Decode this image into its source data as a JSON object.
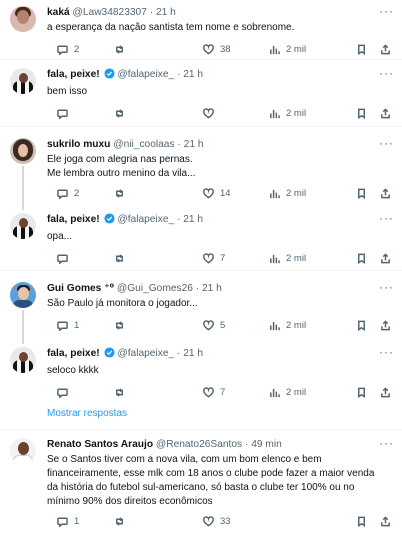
{
  "more_glyph": "···",
  "show_replies": "Mostrar respostas",
  "colors": {
    "link": "#1d9bf0",
    "muted": "#536471",
    "verified": "#1d9bf0"
  },
  "tweets": [
    {
      "name": "kaká",
      "handle": "@Law34823307",
      "dot": "·",
      "time": "21 h",
      "lines": [
        "a esperança da nação santista tem nome e sobrenome."
      ],
      "replies": "2",
      "retweets": "",
      "likes": "38",
      "views": "2 mil"
    },
    {
      "name": "fala, peixe!",
      "handle": "@falapeixe_",
      "dot": "·",
      "time": "21 h",
      "verified": true,
      "lines": [
        "bem isso"
      ],
      "replies": "",
      "retweets": "",
      "likes": "",
      "views": "2 mil"
    },
    {
      "name": "sukrilo muxu",
      "handle": "@nii_coolaas",
      "dot": "·",
      "time": "21 h",
      "lines": [
        "Ele joga com alegria nas pernas.",
        "Me lembra outro menino da vila..."
      ],
      "replies": "2",
      "retweets": "",
      "likes": "14",
      "views": "2 mil"
    },
    {
      "name": "fala, peixe!",
      "handle": "@falapeixe_",
      "dot": "·",
      "time": "21 h",
      "verified": true,
      "lines": [
        "opa..."
      ],
      "replies": "",
      "retweets": "",
      "likes": "7",
      "views": "2 mil"
    },
    {
      "name": "Gui Gomes",
      "name_suffix": "⁺⁰",
      "handle": "@Gui_Gomes26",
      "dot": "·",
      "time": "21 h",
      "lines": [
        "São Paulo já monitora o jogador..."
      ],
      "replies": "1",
      "retweets": "",
      "likes": "5",
      "views": "2 mil"
    },
    {
      "name": "fala, peixe!",
      "handle": "@falapeixe_",
      "dot": "·",
      "time": "21 h",
      "verified": true,
      "lines": [
        "seloco kkkk"
      ],
      "replies": "",
      "retweets": "",
      "likes": "7",
      "views": "2 mil"
    },
    {
      "name": "Renato Santos Araujo",
      "handle": "@Renato26Santos",
      "dot": "·",
      "time": "49 min",
      "lines": [
        "Se o Santos  tiver com a nova vila, com um bom elenco e bem",
        "financeiramente, esse mlk com 18 anos o clube pode fazer a maior venda",
        "da história do futebol sul-americano, só basta o clube  ter 100% ou no",
        "mínimo 90% dos direitos econômicos"
      ],
      "replies": "1",
      "retweets": "",
      "likes": "33",
      "views": ""
    }
  ]
}
